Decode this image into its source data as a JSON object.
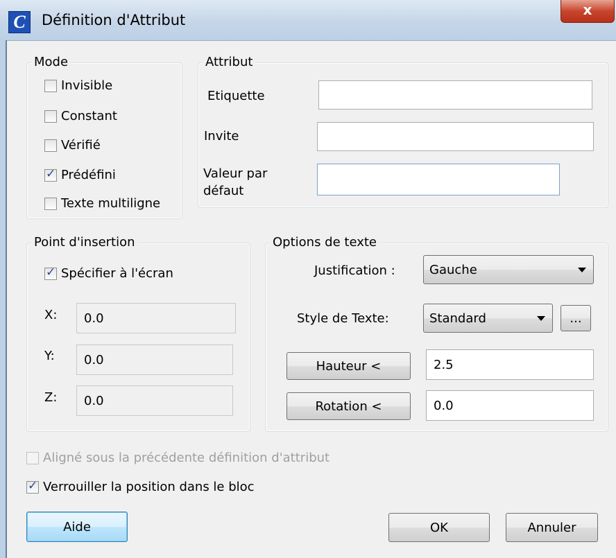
{
  "window": {
    "title": "Définition d'Attribut",
    "close_glyph": "x",
    "app_icon_glyph": "C"
  },
  "mode": {
    "legend": "Mode",
    "items": [
      {
        "label": "Invisible",
        "checked": false
      },
      {
        "label": "Constant",
        "checked": false
      },
      {
        "label": "Vérifié",
        "checked": false
      },
      {
        "label": "Prédéfini",
        "checked": true
      },
      {
        "label": "Texte multiligne",
        "checked": false
      }
    ]
  },
  "attribut": {
    "legend": "Attribut",
    "tag_label": "Etiquette",
    "tag_value": "",
    "prompt_label": "Invite",
    "prompt_value": "",
    "default_label_1": "Valeur par",
    "default_label_2": "défaut",
    "default_value": ""
  },
  "insertion": {
    "legend": "Point d'insertion",
    "specify_label": "Spécifier à l'écran",
    "specify_checked": true,
    "x_label": "X:",
    "x_value": "0.0",
    "y_label": "Y:",
    "y_value": "0.0",
    "z_label": "Z:",
    "z_value": "0.0"
  },
  "text_options": {
    "legend": "Options de texte",
    "justification_label": "Justification :",
    "justification_value": "Gauche",
    "style_label": "Style de Texte:",
    "style_value": "Standard",
    "browse_label": "...",
    "height_button": "Hauteur <",
    "height_value": "2.5",
    "rotation_button": "Rotation <",
    "rotation_value": "0.0"
  },
  "align_below": {
    "label": "Aligné sous la précédente définition d'attribut",
    "checked": false,
    "disabled": true
  },
  "lock_position": {
    "label": "Verrouiller la position dans le bloc",
    "checked": true
  },
  "buttons": {
    "help": "Aide",
    "ok": "OK",
    "cancel": "Annuler"
  }
}
